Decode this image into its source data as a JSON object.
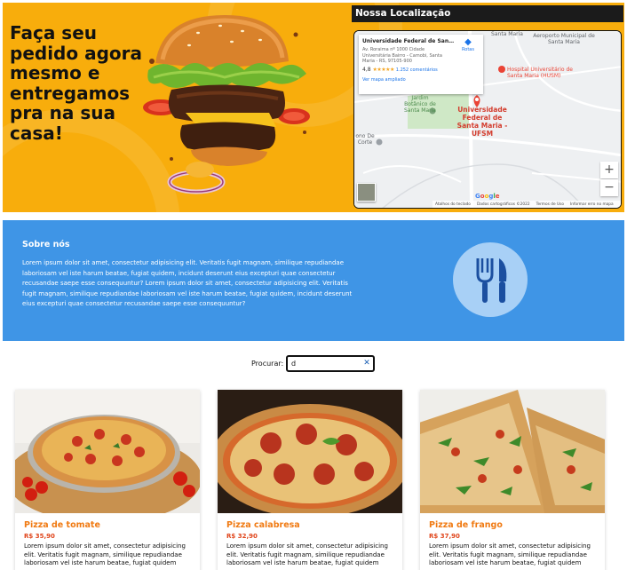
{
  "hero": {
    "headline": "Faça seu pedido agora mesmo e entregamos pra na sua casa!"
  },
  "map": {
    "header": "Nossa Localização",
    "place_name": "Universidade Federal de Santa...",
    "address": "Av. Roraima nº 1000 Cidade Universitária Bairro - Camobi, Santa Maria - RS, 97105-900",
    "rating": "4,8",
    "stars": "★★★★★",
    "reviews": "1.252 comentários",
    "larger_map_link": "Ver mapa ampliado",
    "route_label": "Rotas",
    "labels": {
      "airport": "Aeroporto Municipal de Santa Maria",
      "hospital": "Hospital Universitário de Santa Maria (HUSM)",
      "university": "Universidade Federal de Santa Maria - UFSM",
      "garden": "Jardim Botânico de Santa Maria",
      "santa_maria": "Santa Maria",
      "corte": "ono De Corte",
      "small_right": "nto Municipal de Santa Maria"
    },
    "zoom_in": "+",
    "zoom_out": "−",
    "google": "Google",
    "footer": [
      "Atalhos do teclado",
      "Dados cartográficos ©2022",
      "Termos de Uso",
      "Informar erro no mapa"
    ]
  },
  "about": {
    "title": "Sobre nós",
    "text": "Lorem ipsum dolor sit amet, consectetur adipisicing elit. Veritatis fugit magnam, similique repudiandae laboriosam vel iste harum beatae, fugiat quidem, incidunt deserunt eius excepturi quae consectetur recusandae saepe esse consequuntur? Lorem ipsum dolor sit amet, consectetur adipisicing elit. Veritatis fugit magnam, similique repudiandae laboriosam vel iste harum beatae, fugiat quidem, incidunt deserunt eius excepturi quae consectetur recusandae saepe esse consequuntur?",
    "icon": "fork-knife-icon"
  },
  "search": {
    "label": "Procurar:",
    "value": "d",
    "clear": "✕"
  },
  "products": [
    {
      "title": "Pizza de tomate",
      "price": "R$ 35,90",
      "description": "Lorem ipsum dolor sit amet, consectetur adipisicing elit. Veritatis fugit magnam, similique repudiandae laboriosam vel iste harum beatae, fugiat quidem"
    },
    {
      "title": "Pizza calabresa",
      "price": "R$ 32,90",
      "description": "Lorem ipsum dolor sit amet, consectetur adipisicing elit. Veritatis fugit magnam, similique repudiandae laboriosam vel iste harum beatae, fugiat quidem"
    },
    {
      "title": "Pizza de frango",
      "price": "R$ 37,90",
      "description": "Lorem ipsum dolor sit amet, consectetur adipisicing elit. Veritatis fugit magnam, similique repudiandae laboriosam vel iste harum beatae, fugiat quidem"
    }
  ],
  "colors": {
    "hero_bg": "#f8ad0c",
    "about_bg": "#3f95e6",
    "card_title": "#f07a12",
    "card_price": "#e0461c"
  }
}
